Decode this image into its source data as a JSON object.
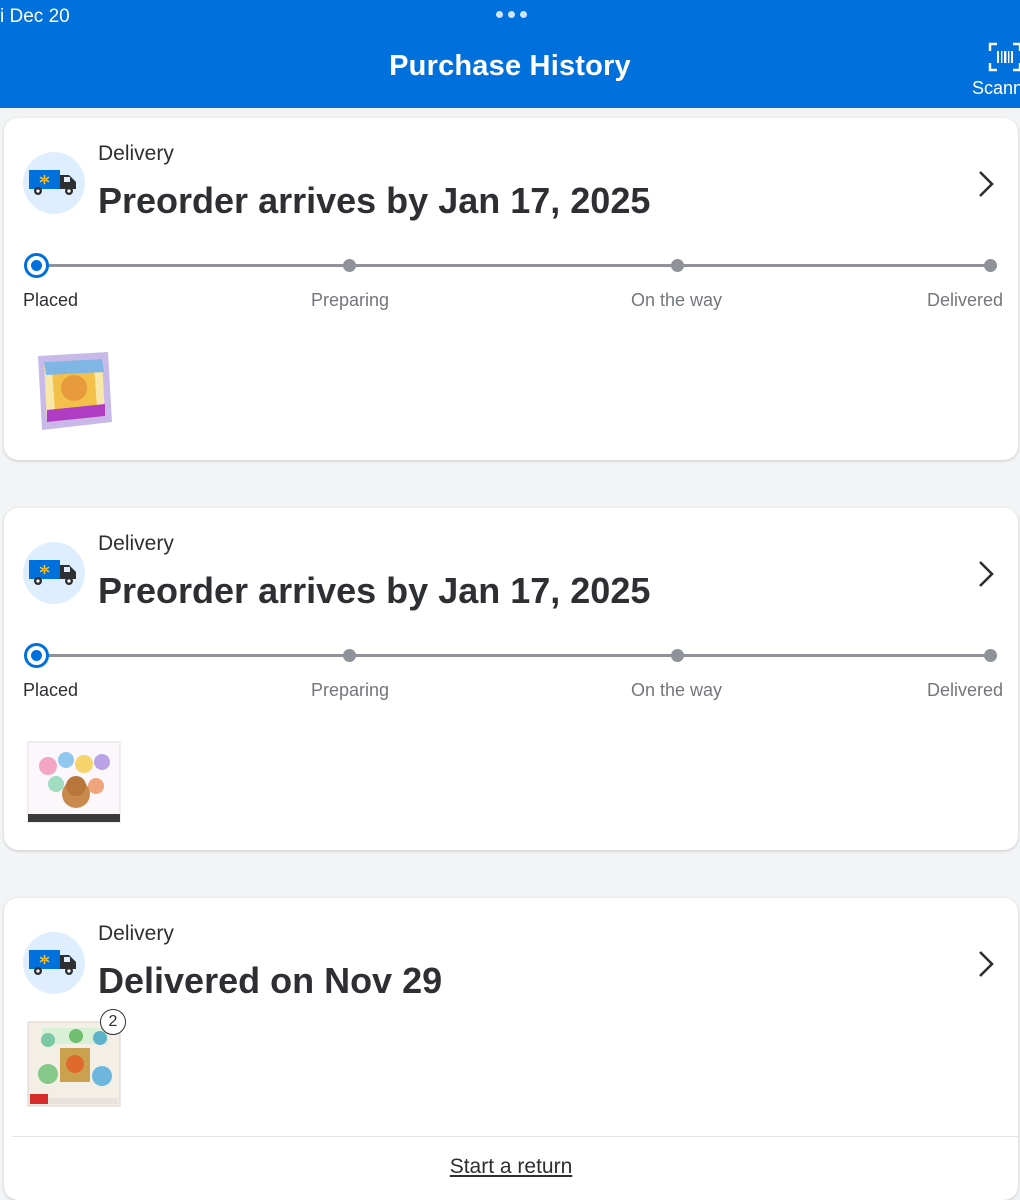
{
  "status_bar": {
    "date": "i Dec 20"
  },
  "header": {
    "title": "Purchase History",
    "scan_label": "Scann",
    "scan_icon": "barcode-scan-icon"
  },
  "colors": {
    "brand_blue": "#0071dc",
    "track_gray": "#8f9298",
    "icon_bg": "#dfeefe",
    "text": "#2e2f32",
    "muted": "#74767c"
  },
  "orders": [
    {
      "kind": "Delivery",
      "headline": "Preorder arrives by Jan 17, 2025",
      "steps": [
        "Placed",
        "Preparing",
        "On the way",
        "Delivered"
      ],
      "current_step": "Placed"
    },
    {
      "kind": "Delivery",
      "headline": "Preorder arrives by Jan 17, 2025",
      "steps": [
        "Placed",
        "Preparing",
        "On the way",
        "Delivered"
      ],
      "current_step": "Placed"
    },
    {
      "kind": "Delivery",
      "headline": "Delivered on Nov 29",
      "item_quantity": "2",
      "action_label": "Start a return"
    }
  ]
}
